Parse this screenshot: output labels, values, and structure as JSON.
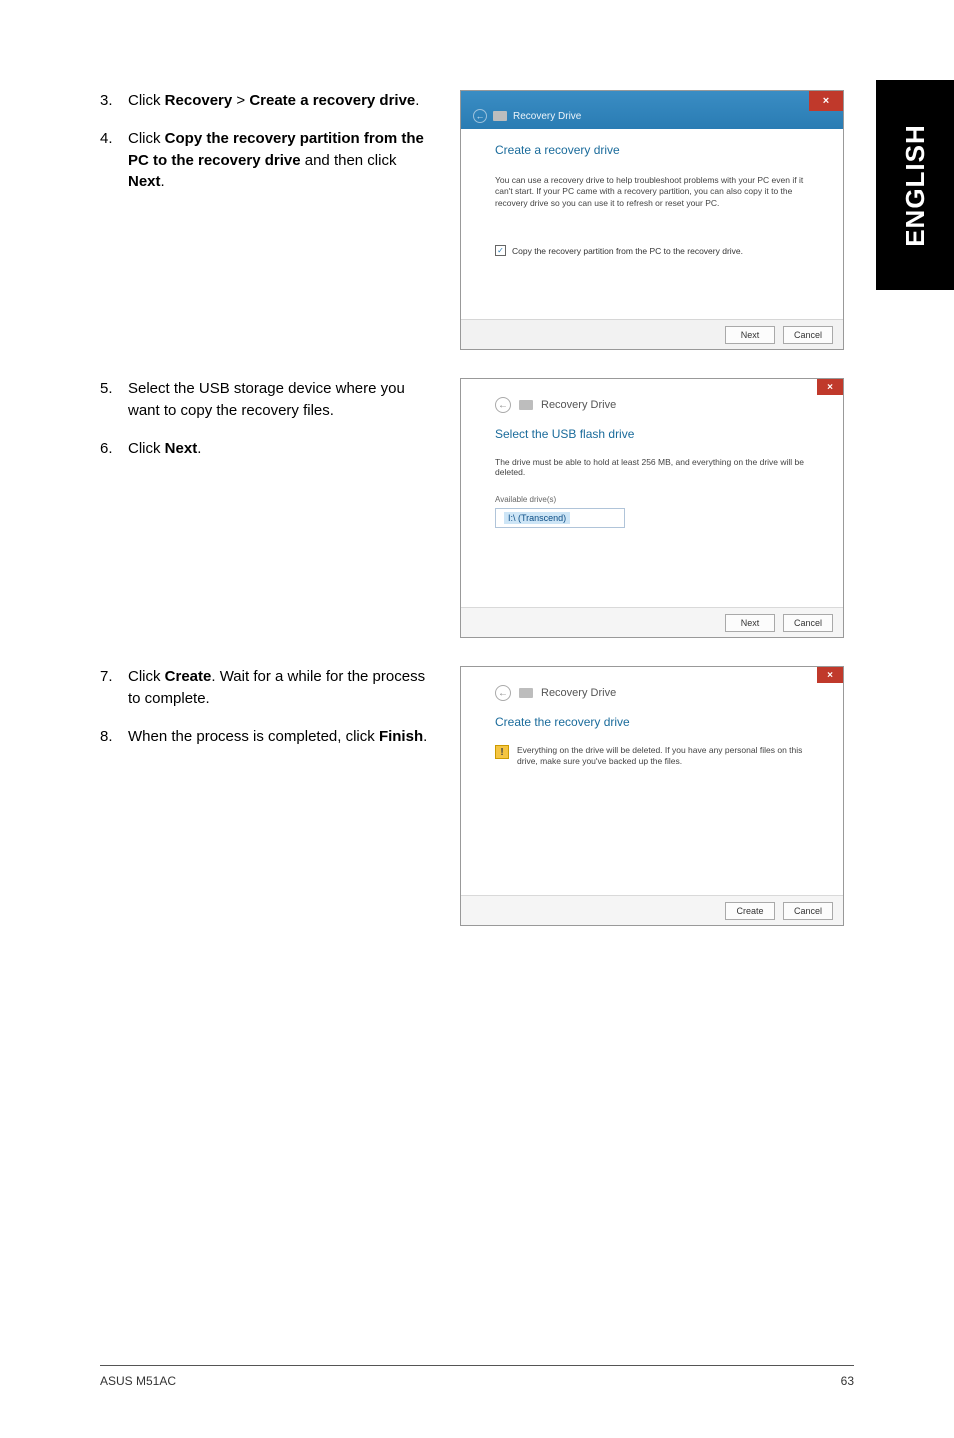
{
  "side_tab": "ENGLISH",
  "block1": {
    "steps": [
      {
        "num": "3.",
        "pre": "Click ",
        "b1": "Recovery",
        "mid": " > ",
        "b2": "Create a recovery drive",
        "post": "."
      },
      {
        "num": "4.",
        "pre": "Click ",
        "b1": "Copy the recovery partition from the PC to the recovery drive",
        "mid": " and then click ",
        "b2": "Next",
        "post": "."
      }
    ],
    "shot": {
      "breadcrumb": "Recovery Drive",
      "heading": "Create a recovery drive",
      "desc": "You can use a recovery drive to help troubleshoot problems with your PC even if it can't start. If your PC came with a recovery partition, you can also copy it to the recovery drive so you can use it to refresh or reset your PC.",
      "checkbox_label": "Copy the recovery partition from the PC to the recovery drive.",
      "check_glyph": "✓",
      "close_glyph": "×",
      "back_glyph": "←",
      "btn_next": "Next",
      "btn_cancel": "Cancel"
    }
  },
  "block2": {
    "steps": [
      {
        "num": "5.",
        "text": "Select the USB storage device where you want to copy the recovery files."
      },
      {
        "num": "6.",
        "pre": "Click ",
        "b1": "Next",
        "post": "."
      }
    ],
    "shot": {
      "title": "Recovery Drive",
      "heading": "Select the USB flash drive",
      "desc": "The drive must be able to hold at least 256 MB, and everything on the drive will be deleted.",
      "avail_label": "Available drive(s)",
      "drive_item": "I:\\ (Transcend)",
      "close_glyph": "×",
      "back_glyph": "←",
      "btn_next": "Next",
      "btn_cancel": "Cancel"
    }
  },
  "block3": {
    "steps": [
      {
        "num": "7.",
        "pre": "Click ",
        "b1": "Create",
        "post": ". Wait for a while for the process to complete."
      },
      {
        "num": "8.",
        "pre": "When the process is completed, click ",
        "b1": "Finish",
        "post": "."
      }
    ],
    "shot": {
      "title": "Recovery Drive",
      "heading": "Create the recovery drive",
      "warn_glyph": "!",
      "warn_text": "Everything on the drive will be deleted. If you have any personal files on this drive, make sure you've backed up the files.",
      "close_glyph": "×",
      "back_glyph": "←",
      "btn_create": "Create",
      "btn_cancel": "Cancel"
    }
  },
  "footer": {
    "model": "ASUS M51AC",
    "page": "63"
  }
}
